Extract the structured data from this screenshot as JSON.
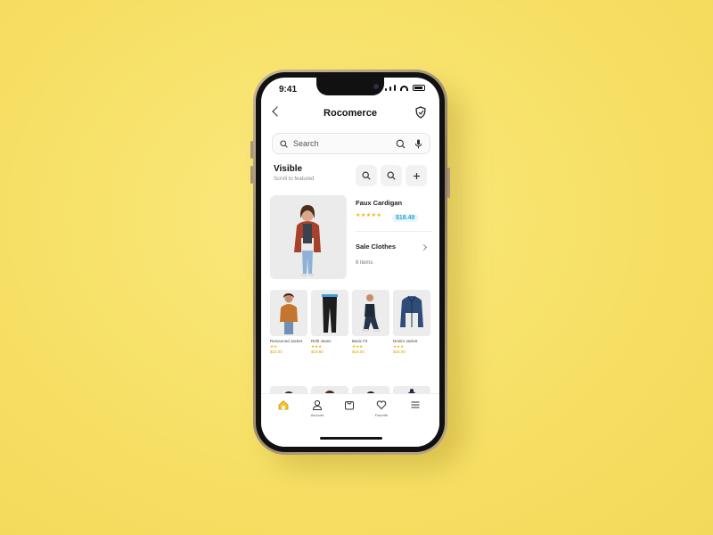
{
  "status": {
    "time": "9:41"
  },
  "header": {
    "title": "Rocomerce"
  },
  "search": {
    "placeholder": "Search"
  },
  "section": {
    "title": "Visible",
    "subtitle": "Scroll to featured"
  },
  "featured": {
    "name": "Faux Cardigan",
    "stars": "★★★★★",
    "price": "$18.49",
    "second_name": "Sale Clothes",
    "second_sub": "6 items"
  },
  "products": [
    {
      "label": "Resourced Jacket",
      "stars": "★★",
      "price": "$22.00"
    },
    {
      "label": "Refit Jeans",
      "stars": "★★★",
      "price": "$19.80"
    },
    {
      "label": "Basic Fit",
      "stars": "★★★",
      "price": "$16.00"
    },
    {
      "label": "Denim Jacket",
      "stars": "★★★",
      "price": "$25.00"
    }
  ],
  "tabs": [
    {
      "label": ""
    },
    {
      "label": "Account"
    },
    {
      "label": ""
    },
    {
      "label": "Favorite"
    },
    {
      "label": ""
    }
  ],
  "colors": {
    "accent": "#f4b400",
    "price": "#2aa7d6",
    "background": "#f6df63"
  }
}
